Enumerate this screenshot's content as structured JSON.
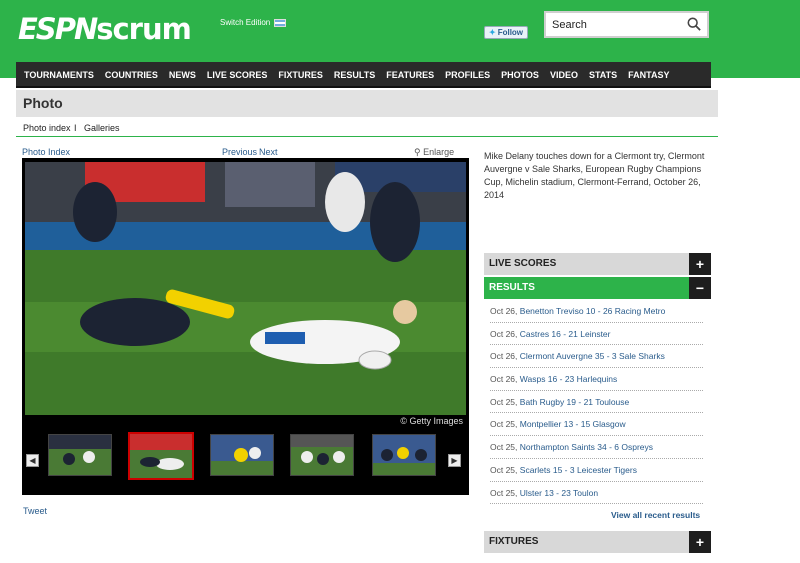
{
  "brand": {
    "logo_part1": "ESPN",
    "logo_part2": "scrum",
    "switch_edition": "Switch Edition",
    "follow": "Follow"
  },
  "search": {
    "placeholder": "Search"
  },
  "nav": {
    "items": [
      "TOURNAMENTS",
      "COUNTRIES",
      "NEWS",
      "LIVE SCORES",
      "FIXTURES",
      "RESULTS",
      "FEATURES",
      "PROFILES",
      "PHOTOS",
      "VIDEO",
      "STATS",
      "FANTASY"
    ]
  },
  "page": {
    "title": "Photo",
    "photo_index": "Photo index",
    "separator": "I",
    "galleries": "Galleries"
  },
  "viewer": {
    "photo_index_link": "Photo Index",
    "previous": "Previous",
    "next": "Next",
    "enlarge": "Enlarge",
    "credit": "© Getty Images",
    "tweet": "Tweet"
  },
  "caption": "Mike Delany touches down for a Clermont try, Clermont Auvergne v Sale Sharks, European Rugby Champions Cup, Michelin stadium, Clermont-Ferrand, October 26, 2014",
  "sidebar": {
    "live_scores": "LIVE SCORES",
    "results": "RESULTS",
    "fixtures": "FIXTURES",
    "plus": "+",
    "minus": "−",
    "view_all": "View all recent results",
    "results_list": [
      {
        "date": "Oct 26,",
        "match": "Benetton Treviso 10 - 26 Racing Metro"
      },
      {
        "date": "Oct 26,",
        "match": "Castres 16 - 21 Leinster"
      },
      {
        "date": "Oct 26,",
        "match": "Clermont Auvergne 35 - 3 Sale Sharks"
      },
      {
        "date": "Oct 26,",
        "match": "Wasps 16 - 23 Harlequins"
      },
      {
        "date": "Oct 25,",
        "match": "Bath Rugby 19 - 21 Toulouse"
      },
      {
        "date": "Oct 25,",
        "match": "Montpellier 13 - 15 Glasgow"
      },
      {
        "date": "Oct 25,",
        "match": "Northampton Saints 34 - 6 Ospreys"
      },
      {
        "date": "Oct 25,",
        "match": "Scarlets 15 - 3 Leicester Tigers"
      },
      {
        "date": "Oct 25,",
        "match": "Ulster 13 - 23 Toulon"
      }
    ]
  },
  "colors": {
    "brand_green": "#2db34a",
    "nav_dark": "#2a2a2a",
    "link_blue": "#2a5c8c"
  }
}
